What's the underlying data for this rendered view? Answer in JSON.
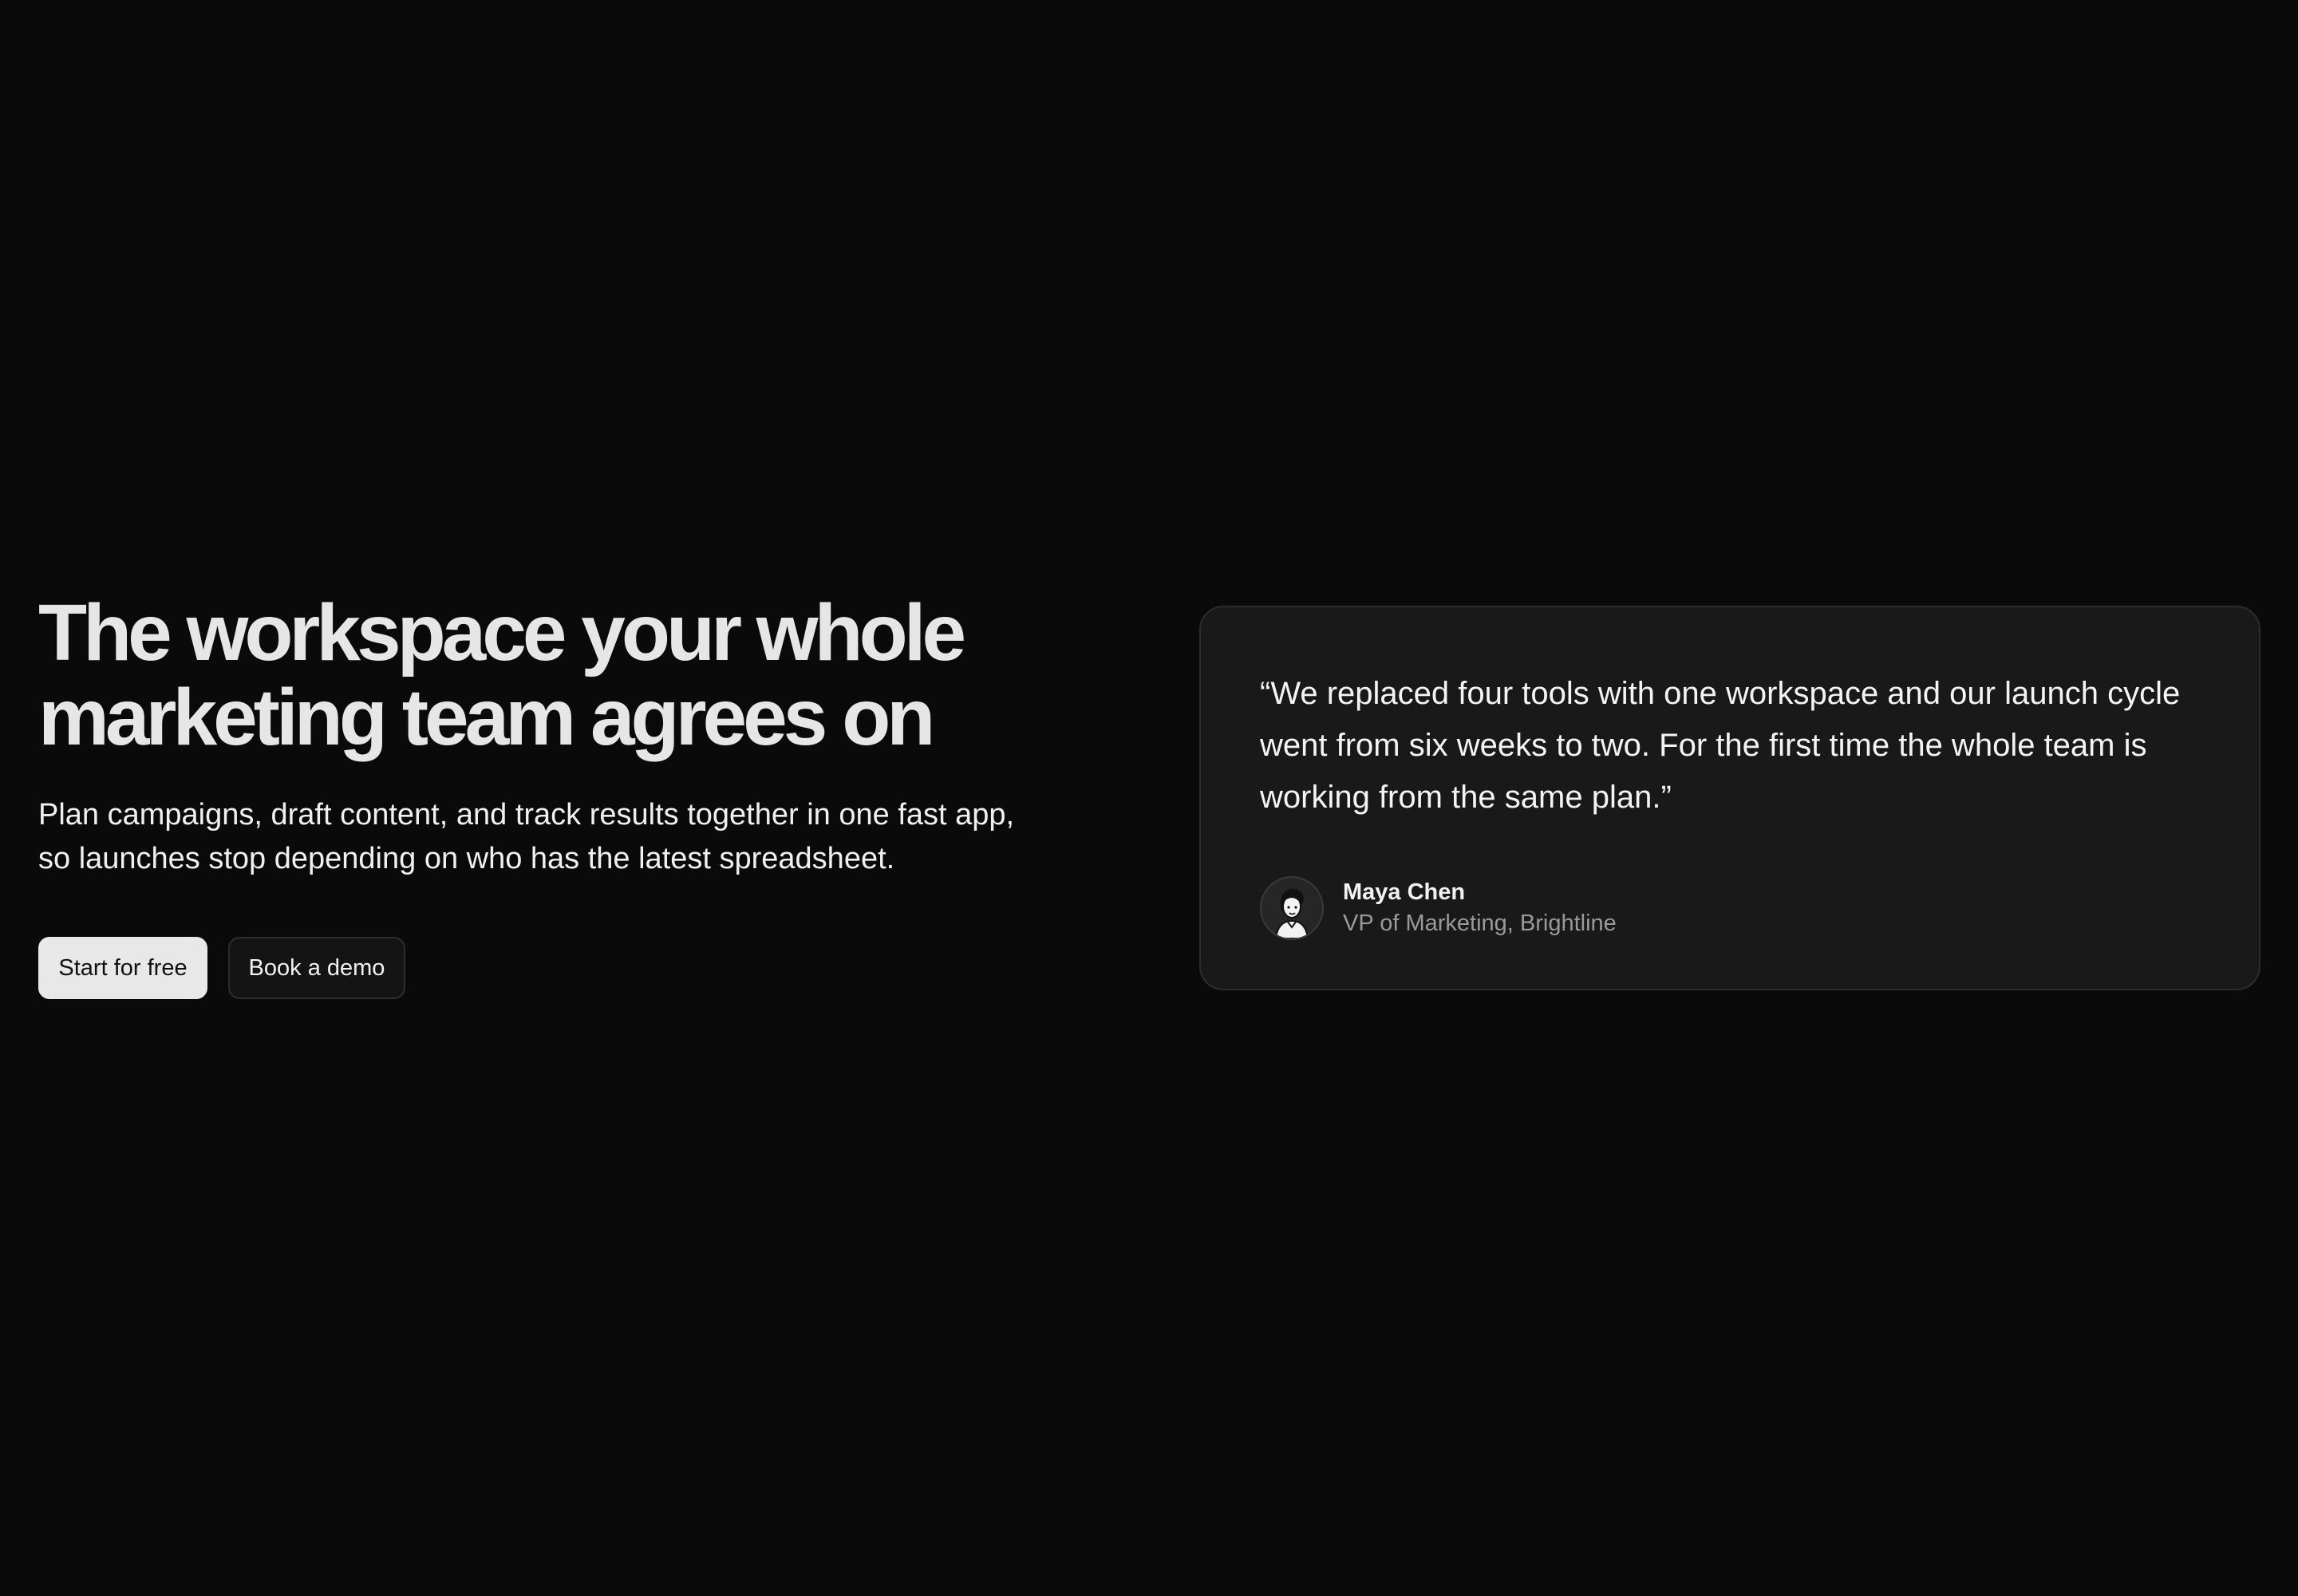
{
  "hero": {
    "headline": "The workspace your whole marketing team agrees on",
    "subhead": "Plan campaigns, draft content, and track results together in one fast app, so launches stop depending on who has the latest spreadsheet.",
    "primary_cta": "Start for free",
    "secondary_cta": "Book a demo"
  },
  "testimonial": {
    "quote": "“We replaced four tools with one workspace and our launch cycle went from six weeks to two. For the first time the whole team is working from the same plan.”",
    "author_name": "Maya Chen",
    "author_role": "VP of Marketing, Brightline",
    "avatar_icon": "person-avatar-icon"
  },
  "colors": {
    "background": "#0a0a0a",
    "card_background": "#191919",
    "card_border": "#2c2c2c",
    "primary_button": "#e8e8e8",
    "muted_text": "#9a9a9a"
  }
}
